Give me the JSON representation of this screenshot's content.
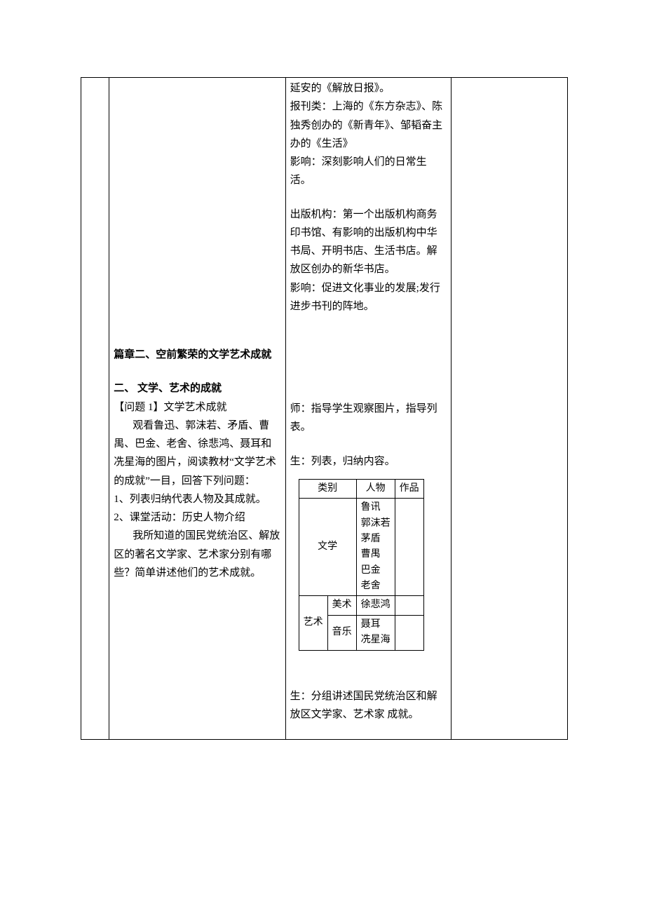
{
  "col3_top": {
    "line1": "延安的《解放日报》。",
    "line2": "报刊类：上海的《东方杂志》、陈独秀创办的《新青年》、邹韬奋主办的《生活》",
    "line3": "影响：深刻影响人们的日常生活。",
    "line4": "出版机构：第一个出版机构商务印书馆、有影响的出版机构中华书局、开明书店、生活书店。解放区创办的新华书店。",
    "line5": "影响：促进文化事业的发展;发行进步书刊的阵地。"
  },
  "col2_mid": {
    "h1": "篇章二、空前繁荣的文学艺术成就",
    "h2": "二、 文学、艺术的成就",
    "q_label": "【问题 1】文学艺术成就",
    "p1": "观看鲁迅、郭沫若、矛盾、曹禺、巴金、老舍、徐悲鸿、聂耳和冼星海的图片，阅读教材“文学艺术的成就”一目，回答下列问题：",
    "li1": "1、列表归纳代表人物及其成就。",
    "li2": "2、课堂活动：历史人物介绍",
    "p2": "我所知道的国民党统治区、解放区的著名文学家、艺术家分别有哪些？简单讲述他们的艺术成就。"
  },
  "col3_mid": {
    "t1": "师：指导学生观察图片，指导列表。",
    "t2": "生：列表，归纳内容。",
    "table": {
      "h_cat": "类别",
      "h_person": "人物",
      "h_work": "作品",
      "lit_label": "文学",
      "lit_persons": "鲁讯\n郭沫若\n茅盾\n曹禺\n巴金\n老舍",
      "art_label": "艺术",
      "art_sub1": "美术",
      "art_p1": "徐悲鸿",
      "art_sub2": "音乐",
      "art_p2": "聂耳\n冼星海"
    },
    "t3": "生：分组讲述国民党统治区和解放区文学家、艺术家 成就。"
  }
}
